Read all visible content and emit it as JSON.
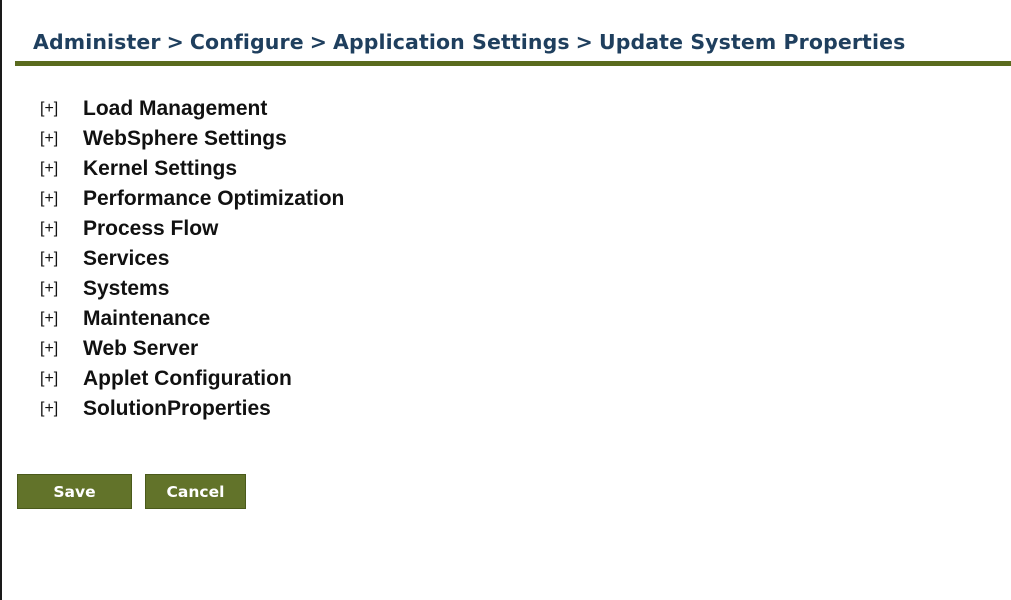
{
  "breadcrumb": {
    "items": [
      "Administer",
      "Configure",
      "Application Settings",
      "Update System Properties"
    ],
    "separator": ">"
  },
  "tree": {
    "toggle_label": "[+]",
    "items": [
      "Load Management",
      "WebSphere Settings",
      "Kernel Settings",
      "Performance Optimization",
      "Process Flow",
      "Services",
      "Systems",
      "Maintenance",
      "Web Server",
      "Applet Configuration",
      "SolutionProperties"
    ]
  },
  "actions": {
    "save_label": "Save",
    "cancel_label": "Cancel"
  },
  "colors": {
    "breadcrumb_text": "#1f3f5e",
    "header_rule": "#5a6b1e",
    "button_bg": "#62732a",
    "button_text": "#ffffff"
  }
}
